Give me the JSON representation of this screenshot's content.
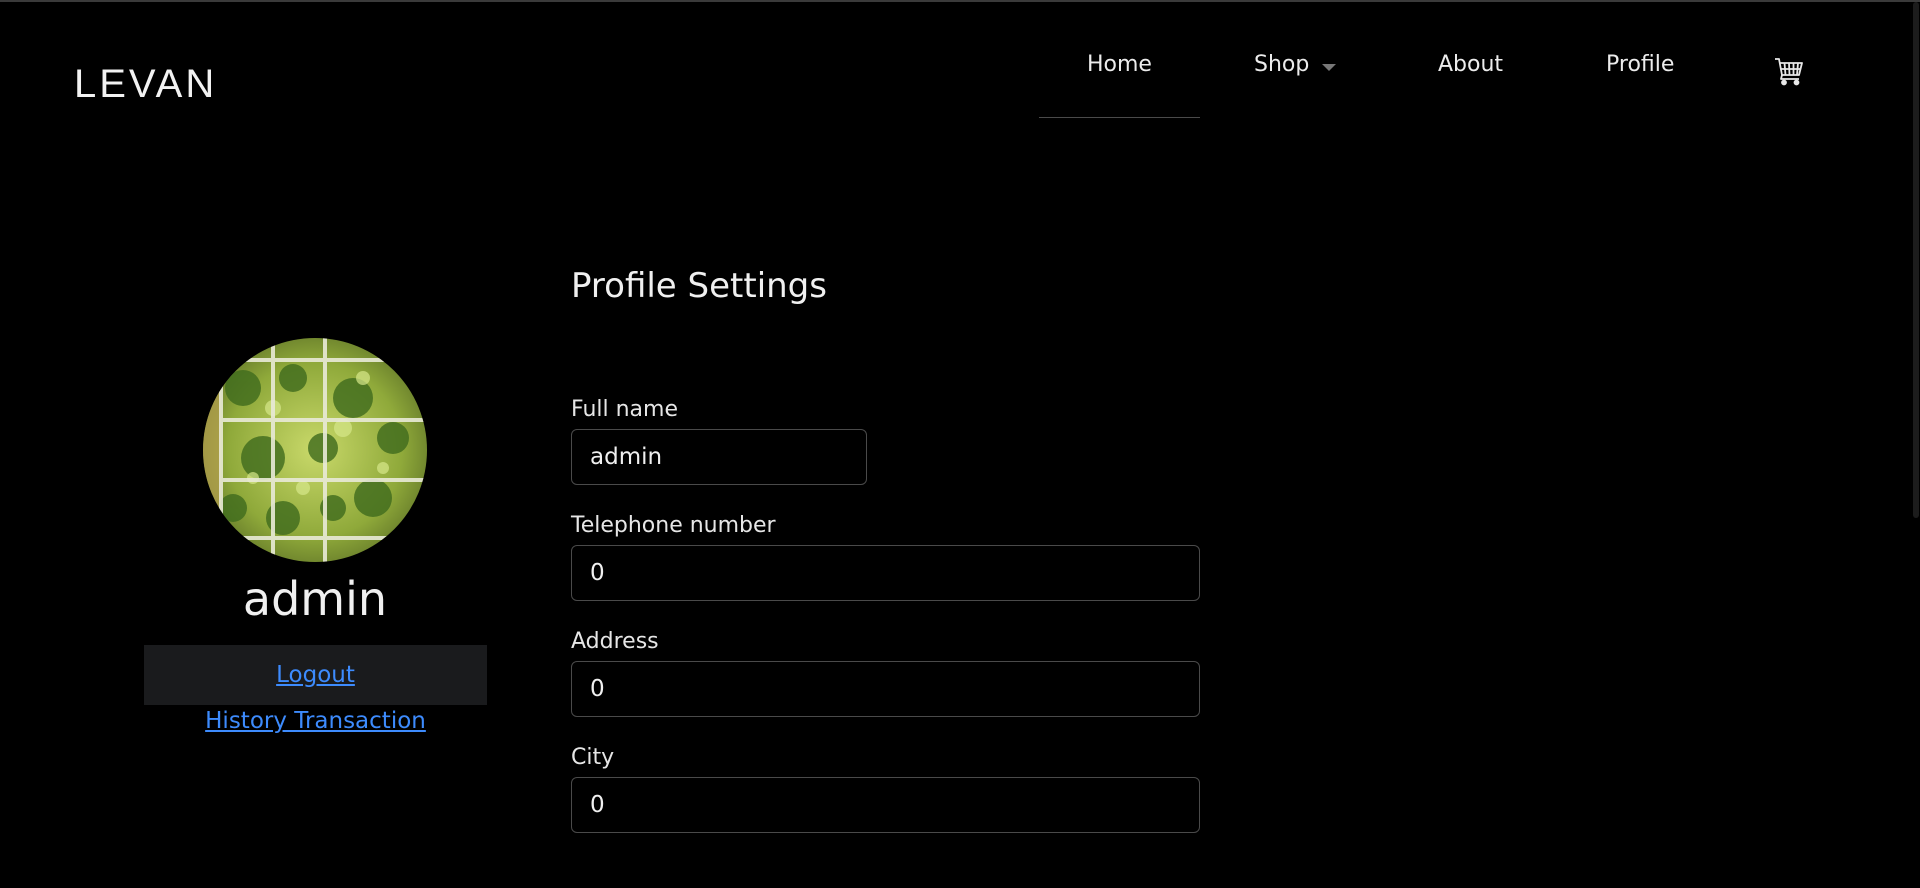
{
  "brand": "LEVAN",
  "nav": {
    "home": "Home",
    "shop": "Shop",
    "about": "About",
    "profile": "Profile",
    "cart_icon": "cart-icon"
  },
  "profile_card": {
    "username": "admin",
    "logout": "Logout",
    "history": "History Transaction"
  },
  "settings": {
    "title": "Profile Settings",
    "fields": [
      {
        "label": "Full name",
        "value": "admin"
      },
      {
        "label": "Telephone number",
        "value": "0"
      },
      {
        "label": "Address",
        "value": "0"
      },
      {
        "label": "City",
        "value": "0"
      }
    ]
  },
  "colors": {
    "background": "#000000",
    "link": "#3d8bfd",
    "logout_bg": "#1a1b1d",
    "input_border": "#4a4a4a"
  }
}
